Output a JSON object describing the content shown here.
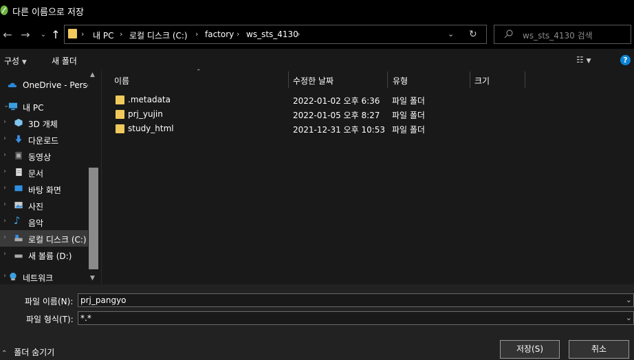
{
  "window": {
    "title": "다른 이름으로 저장"
  },
  "nav": {
    "back_icon": "back-arrow-icon",
    "forward_icon": "forward-arrow-icon",
    "recent_icon": "chevron-down-icon",
    "up_icon": "up-arrow-icon",
    "breadcrumbs": [
      "내 PC",
      "로컬 디스크 (C:)",
      "factory",
      "ws_sts_4130"
    ],
    "search_placeholder": "ws_sts_4130 검색"
  },
  "toolbar": {
    "organize": "구성",
    "new_folder": "새 폴더",
    "help": "?"
  },
  "sidebar": {
    "items": [
      {
        "label": "OneDrive - Persol",
        "icon": "cloud-icon"
      },
      {
        "label": "내 PC",
        "icon": "computer-icon"
      },
      {
        "label": "3D 개체",
        "icon": "cube-icon"
      },
      {
        "label": "다운로드",
        "icon": "download-icon"
      },
      {
        "label": "동영상",
        "icon": "video-icon"
      },
      {
        "label": "문서",
        "icon": "document-icon"
      },
      {
        "label": "바탕 화면",
        "icon": "desktop-icon"
      },
      {
        "label": "사진",
        "icon": "picture-icon"
      },
      {
        "label": "음악",
        "icon": "music-icon"
      },
      {
        "label": "로컬 디스크 (C:)",
        "icon": "drive-icon"
      },
      {
        "label": "새 볼륨 (D:)",
        "icon": "drive-icon"
      },
      {
        "label": "네트워크",
        "icon": "network-icon"
      }
    ]
  },
  "columns": {
    "name": "이름",
    "modified": "수정한 날짜",
    "type": "유형",
    "size": "크기"
  },
  "files": [
    {
      "name": ".metadata",
      "modified": "2022-01-02 오후 6:36",
      "type": "파일 폴더"
    },
    {
      "name": "prj_yujin",
      "modified": "2022-01-05 오후 8:27",
      "type": "파일 폴더"
    },
    {
      "name": "study_html",
      "modified": "2021-12-31 오후 10:53",
      "type": "파일 폴더"
    }
  ],
  "bottom": {
    "filename_label": "파일 이름(N):",
    "filename_value": "prj_pangyo",
    "filetype_label": "파일 형식(T):",
    "filetype_value": "*.*",
    "hide_folders": "폴더 숨기기",
    "save_button": "저장(S)",
    "cancel_button": "취소"
  },
  "colors": {
    "folder": "#f0c95c",
    "accent": "#0a84d8",
    "background": "#191919"
  }
}
